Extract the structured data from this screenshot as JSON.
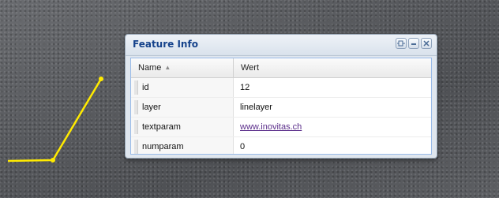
{
  "window": {
    "title": "Feature Info",
    "tools": [
      "pin-icon",
      "minimize-icon",
      "close-icon"
    ]
  },
  "grid": {
    "columns": {
      "name": "Name",
      "value": "Wert"
    },
    "sort": "ascending",
    "rows": [
      {
        "name": "id",
        "value": "12",
        "link": false
      },
      {
        "name": "layer",
        "value": "linelayer",
        "link": false
      },
      {
        "name": "textparam",
        "value": "www.inovitas.ch",
        "link": true
      },
      {
        "name": "numparam",
        "value": "0",
        "link": false
      }
    ]
  },
  "map": {
    "line_color": "#ffea00"
  }
}
